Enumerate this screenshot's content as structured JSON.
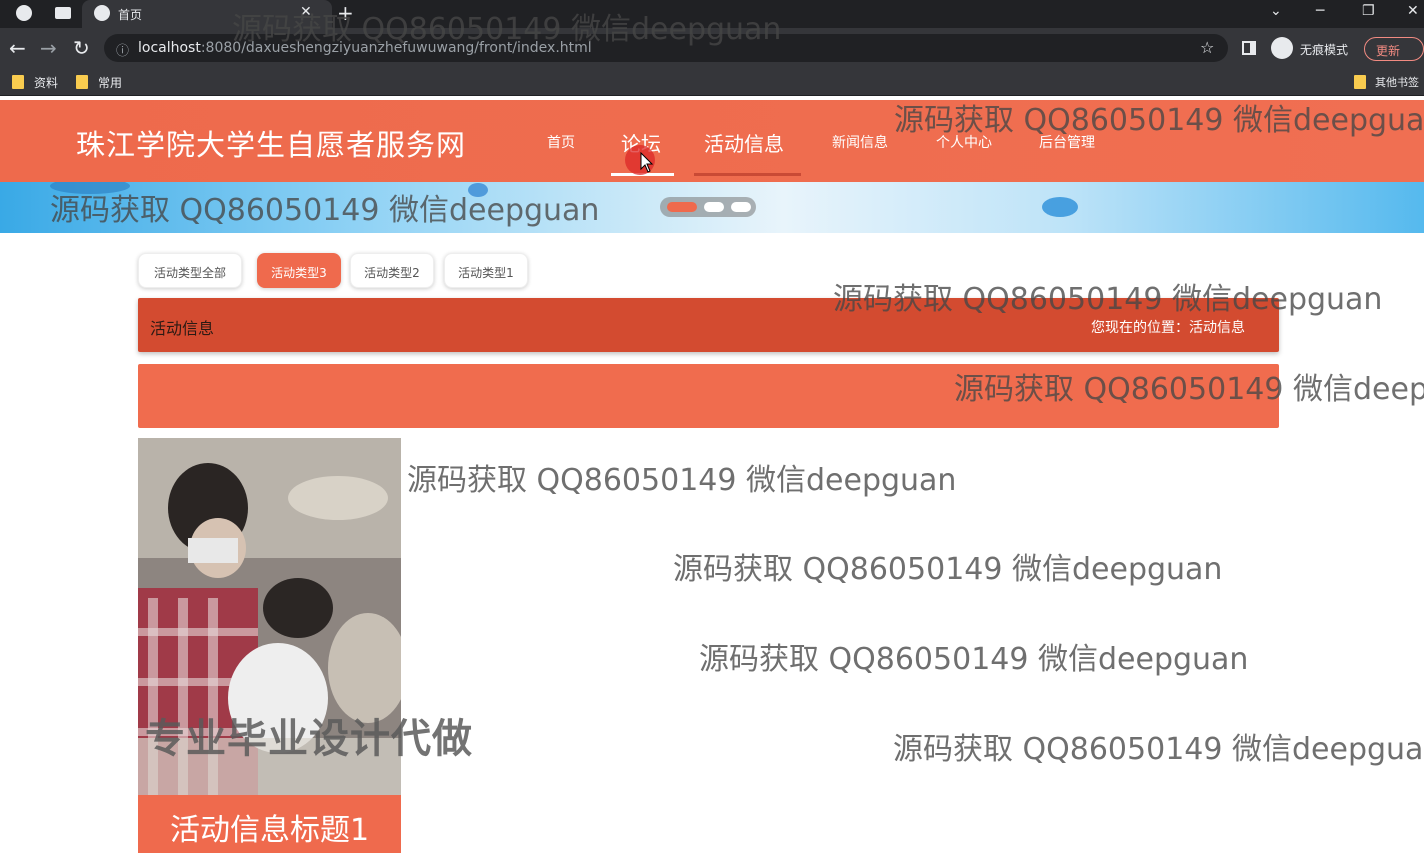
{
  "browser": {
    "tab_title": "首页",
    "url_host": "localhost",
    "url_path": ":8080/daxueshengziyuanzhefuwuwang/front/index.html",
    "incognito_label": "无痕模式",
    "update_label": "更新",
    "bookmarks": [
      "资料",
      "常用",
      "其他书签"
    ]
  },
  "site": {
    "title": "珠江学院大学生自愿者服务网",
    "nav": [
      "首页",
      "论坛",
      "活动信息",
      "新闻信息",
      "个人中心",
      "后台管理"
    ]
  },
  "filters": [
    "活动类型全部",
    "活动类型3",
    "活动类型2",
    "活动类型1"
  ],
  "section": {
    "title": "活动信息",
    "breadcrumb": "您现在的位置：活动信息"
  },
  "card": {
    "overlay_text": "专业毕业设计代做",
    "caption": "活动信息标题1"
  },
  "watermark": "源码获取 QQ86050149 微信deepguan",
  "colors": {
    "header": "#ef6a4d",
    "section_bar": "#d34b30",
    "active_filter": "#ef6a4d"
  }
}
